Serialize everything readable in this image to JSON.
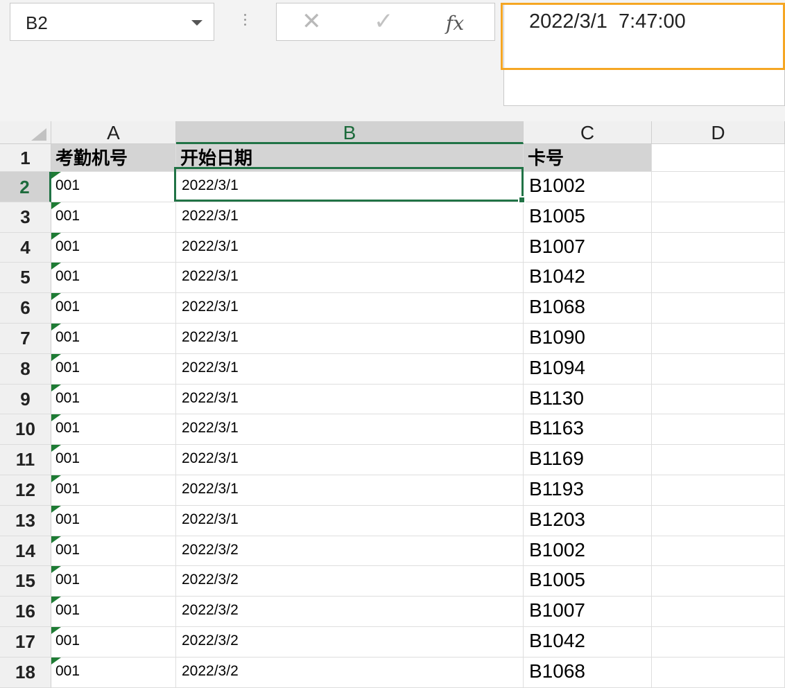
{
  "name_box": {
    "value": "B2"
  },
  "formula_bar": {
    "cancel_icon": "✕",
    "enter_icon": "✓",
    "fx_icon": "fx",
    "content": "2022/3/1  7:47:00",
    "highlight_color": "#f5a623"
  },
  "columns": [
    "A",
    "B",
    "C",
    "D"
  ],
  "selected_cell": "B2",
  "accent_color": "#217346",
  "row_numbers": [
    "1",
    "2",
    "3",
    "4",
    "5",
    "6",
    "7",
    "8",
    "9",
    "10",
    "11",
    "12",
    "13",
    "14",
    "15",
    "16",
    "17",
    "18"
  ],
  "rows": [
    [
      "考勤机号",
      "开始日期",
      "卡号"
    ],
    [
      "001",
      "2022/3/1",
      "B1002"
    ],
    [
      "001",
      "2022/3/1",
      "B1005"
    ],
    [
      "001",
      "2022/3/1",
      "B1007"
    ],
    [
      "001",
      "2022/3/1",
      "B1042"
    ],
    [
      "001",
      "2022/3/1",
      "B1068"
    ],
    [
      "001",
      "2022/3/1",
      "B1090"
    ],
    [
      "001",
      "2022/3/1",
      "B1094"
    ],
    [
      "001",
      "2022/3/1",
      "B1130"
    ],
    [
      "001",
      "2022/3/1",
      "B1163"
    ],
    [
      "001",
      "2022/3/1",
      "B1169"
    ],
    [
      "001",
      "2022/3/1",
      "B1193"
    ],
    [
      "001",
      "2022/3/1",
      "B1203"
    ],
    [
      "001",
      "2022/3/2",
      "B1002"
    ],
    [
      "001",
      "2022/3/2",
      "B1005"
    ],
    [
      "001",
      "2022/3/2",
      "B1007"
    ],
    [
      "001",
      "2022/3/2",
      "B1042"
    ],
    [
      "001",
      "2022/3/2",
      "B1068"
    ]
  ]
}
